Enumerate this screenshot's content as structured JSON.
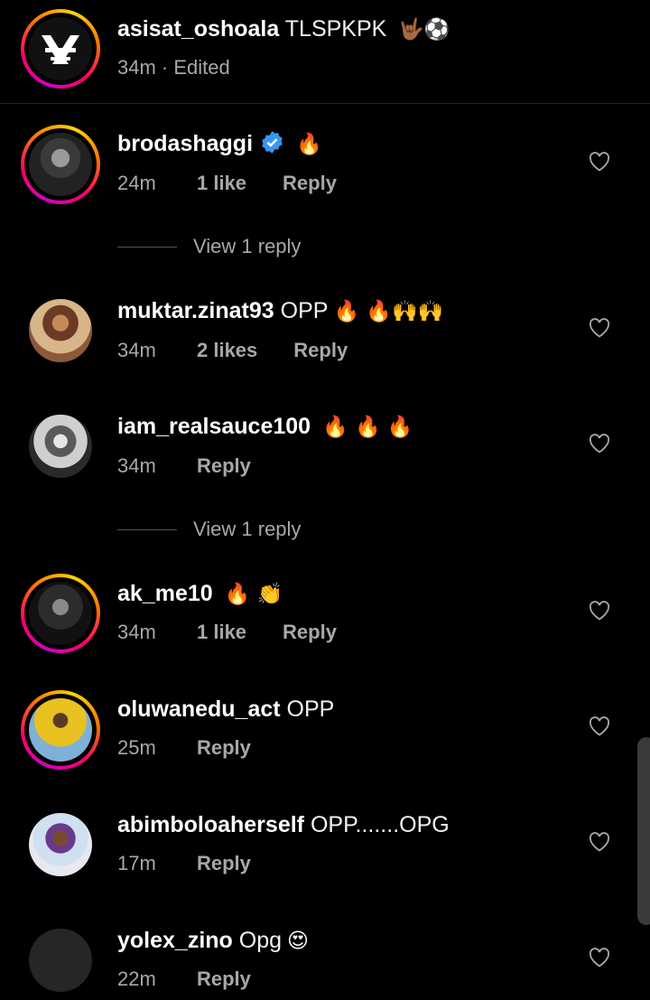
{
  "caption": {
    "username": "asisat_oshoala",
    "text": "TLSPKPK",
    "emoji": "🤟🏾⚽",
    "meta": "34m · Edited"
  },
  "comments": [
    {
      "username": "brodashaggi",
      "verified": true,
      "text": "",
      "emoji": "🔥",
      "time": "24m",
      "likes": "1 like",
      "reply": "Reply",
      "view_replies": "View 1 reply"
    },
    {
      "username": "muktar.zinat93",
      "text": "OPP",
      "emoji": "🔥 🔥🙌🙌",
      "time": "34m",
      "likes": "2 likes",
      "reply": "Reply"
    },
    {
      "username": "iam_realsauce100",
      "text": "",
      "emoji": "🔥 🔥 🔥",
      "time": "34m",
      "likes": "",
      "reply": "Reply",
      "view_replies": "View 1 reply"
    },
    {
      "username": "ak_me10",
      "text": "",
      "emoji": "🔥 👏",
      "time": "34m",
      "likes": "1 like",
      "reply": "Reply"
    },
    {
      "username": "oluwanedu_act",
      "text": "OPP",
      "emoji": "",
      "time": "25m",
      "likes": "",
      "reply": "Reply"
    },
    {
      "username": "abimboloaherself",
      "text": "OPP.......OPG",
      "emoji": "",
      "time": "17m",
      "likes": "",
      "reply": "Reply"
    },
    {
      "username": "yolex_zino",
      "text": "Opg",
      "emoji": "😍",
      "time": "22m",
      "likes": "",
      "reply": "Reply"
    }
  ],
  "colors": {
    "background": "#000000",
    "secondary_text": "#a8a8a8",
    "verified_blue": "#3897f0"
  }
}
